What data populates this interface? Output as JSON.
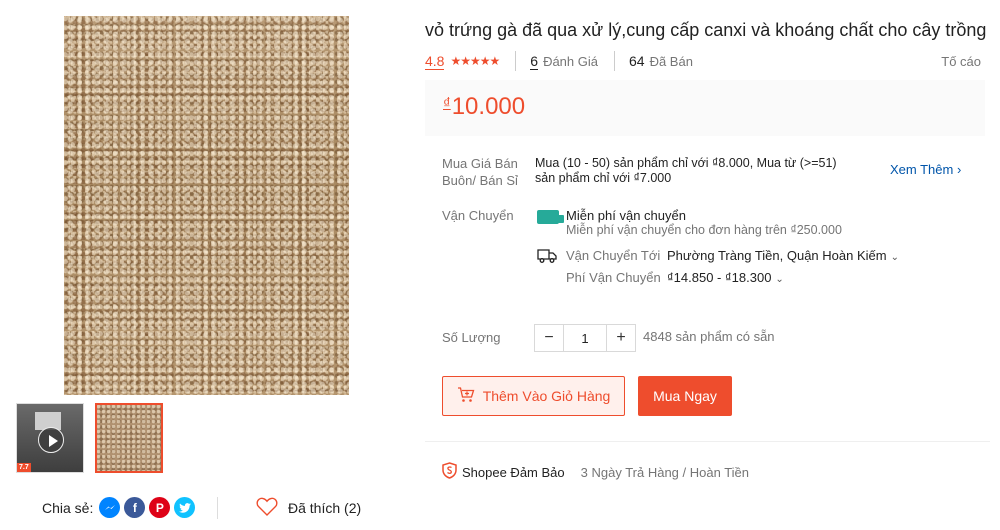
{
  "product": {
    "title": "vỏ trứng gà đã qua xử lý,cung cấp canxi và khoáng chất cho cây trồng",
    "rating": "4.8",
    "stars": "★★★★★",
    "reviews_count": "6",
    "reviews_label": "Đánh Giá",
    "sold_count": "64",
    "sold_label": "Đã Bán",
    "report_label": "Tố cáo",
    "price_currency": "₫",
    "price": "10.000"
  },
  "wholesale": {
    "label_line1": "Mua Giá Bán",
    "label_line2": "Buôn/ Bán Sỉ",
    "text": "Mua (10 - 50) sản phẩm chỉ với ₫8.000, Mua từ (>=51) sản phẩm chỉ với ₫7.000",
    "see_more": "Xem Thêm ›"
  },
  "shipping": {
    "label": "Vận Chuyển",
    "free_title": "Miễn phí vận chuyển",
    "free_sub": "Miễn phí vận chuyển cho đơn hàng trên ₫250.000",
    "to_label": "Vận Chuyển Tới",
    "to_value": "Phường Tràng Tiền, Quận Hoàn Kiếm",
    "fee_label": "Phí Vận Chuyển",
    "fee_value": "₫14.850 - ₫18.300"
  },
  "quantity": {
    "label": "Số Lượng",
    "minus": "−",
    "value": "1",
    "plus": "+",
    "stock": "4848 sản phẩm có sẵn"
  },
  "actions": {
    "add_to_cart": "Thêm Vào Giỏ Hàng",
    "buy_now": "Mua Ngay"
  },
  "guarantee": {
    "title": "Shopee Đảm Bảo",
    "sub": "3 Ngày Trả Hàng / Hoàn Tiền"
  },
  "share": {
    "label": "Chia sẻ:",
    "like_label": "Đã thích (2)"
  },
  "gallery": {
    "video_tag": "7.7"
  },
  "colors": {
    "accent": "#ee4d2d",
    "link": "#0055aa",
    "teal": "#26aa99"
  }
}
